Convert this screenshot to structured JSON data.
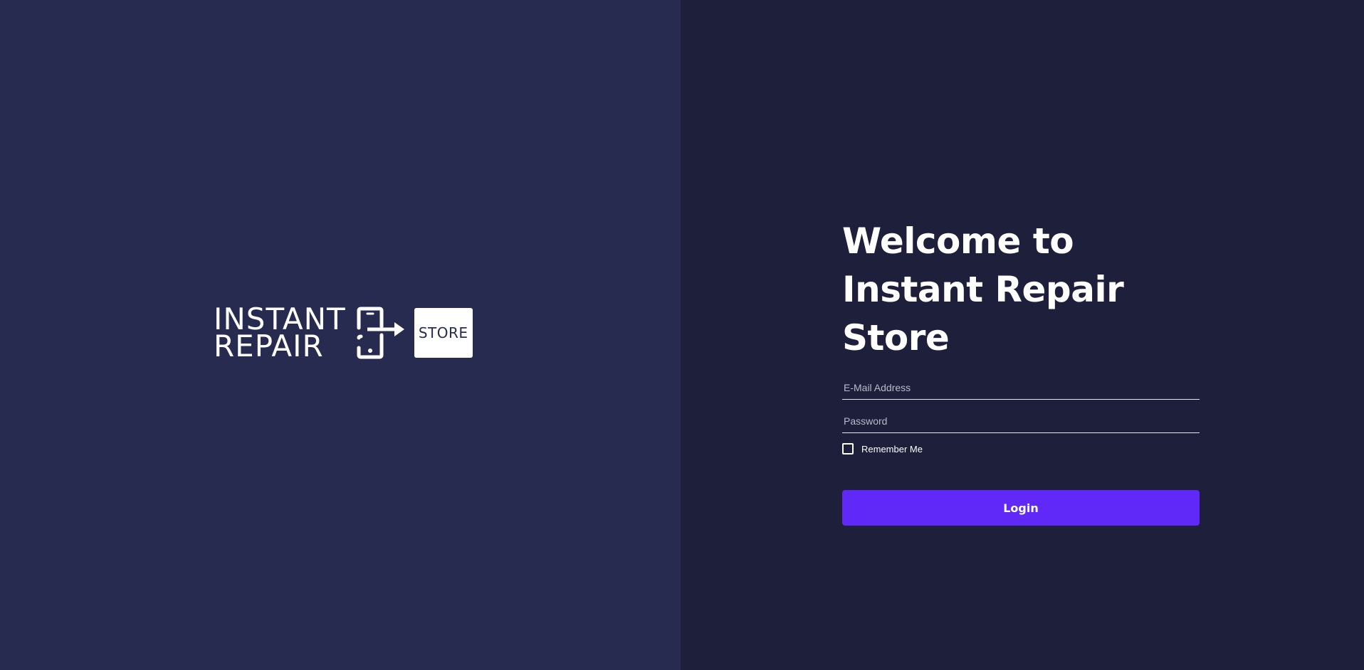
{
  "brand": {
    "logo_line1": "INSTANT",
    "logo_line2": "REPAIR",
    "logo_store": "STORE",
    "device_icon": "device-transfer-icon"
  },
  "login": {
    "title_line1": "Welcome to",
    "title_line2": "Instant Repair Store",
    "email_placeholder": "E-Mail Address",
    "email_value": "",
    "password_placeholder": "Password",
    "password_value": "",
    "remember_label": "Remember Me",
    "remember_checked": false,
    "login_label": "Login"
  },
  "colors": {
    "left_panel_bg": "#282b50",
    "right_panel_bg": "#1d1f3b",
    "accent": "#6129f8",
    "text": "#ffffff"
  }
}
